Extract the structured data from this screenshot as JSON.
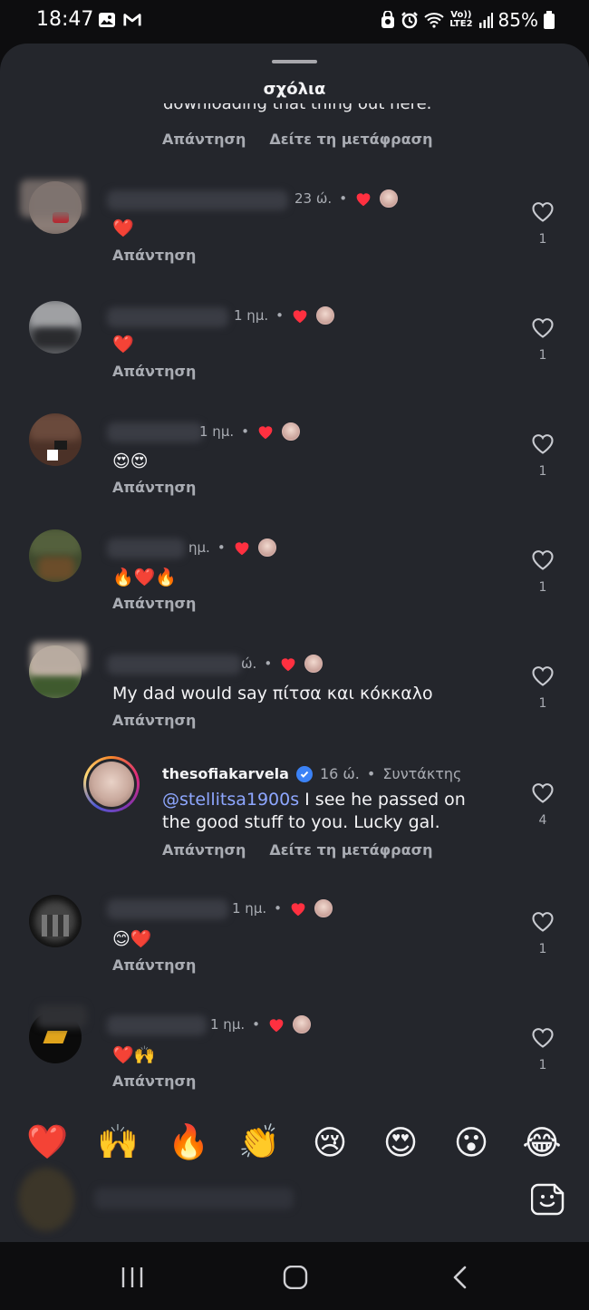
{
  "status_bar": {
    "time": "18:47",
    "battery": "85%",
    "network": "LTE2",
    "volte": "Vo))"
  },
  "sheet": {
    "title": "σχόλια"
  },
  "labels": {
    "reply": "Απάντηση",
    "see_translation": "Δείτε τη μετάφραση"
  },
  "partial_comment": {
    "text": "downloading that thing out here."
  },
  "comments": [
    {
      "time": "23 ώ.",
      "content": "❤️",
      "likes": "1"
    },
    {
      "time": "1 ημ.",
      "content": "❤️",
      "likes": "1"
    },
    {
      "time": "1 ημ.",
      "content": "😍😍",
      "likes": "1"
    },
    {
      "time": "ημ.",
      "content": "🔥❤️🔥",
      "likes": "1"
    },
    {
      "time": "ώ.",
      "content": "My dad would say πίτσα και κόκκαλο",
      "likes": "1"
    },
    {
      "time": "1 ημ.",
      "content": "😊❤️",
      "likes": "1"
    },
    {
      "time": "1 ημ.",
      "content": "❤️🙌",
      "likes": "1"
    }
  ],
  "reply": {
    "author": "thesofiakarvela",
    "time": "16 ώ.",
    "role": "Συντάκτης",
    "mention": "@stellitsa1900s",
    "text_line1": " I see he passed on",
    "text_line2": "the good stuff to you. Lucky gal.",
    "likes": "4"
  },
  "reactions": [
    "❤️",
    "🙌",
    "🔥",
    "👏",
    "😢",
    "😍",
    "😮",
    "😂"
  ],
  "icons": {
    "heart_outline": "heart-outline-icon",
    "sticker": "sticker-icon",
    "nav_recents": "recents-icon",
    "nav_home": "home-icon",
    "nav_back": "back-icon"
  },
  "colors": {
    "sheet_bg": "#24262c",
    "muted_text": "#a9acb3",
    "heart_red": "#ff3040",
    "mention": "#8ea7ff",
    "verified": "#3b82f6"
  }
}
